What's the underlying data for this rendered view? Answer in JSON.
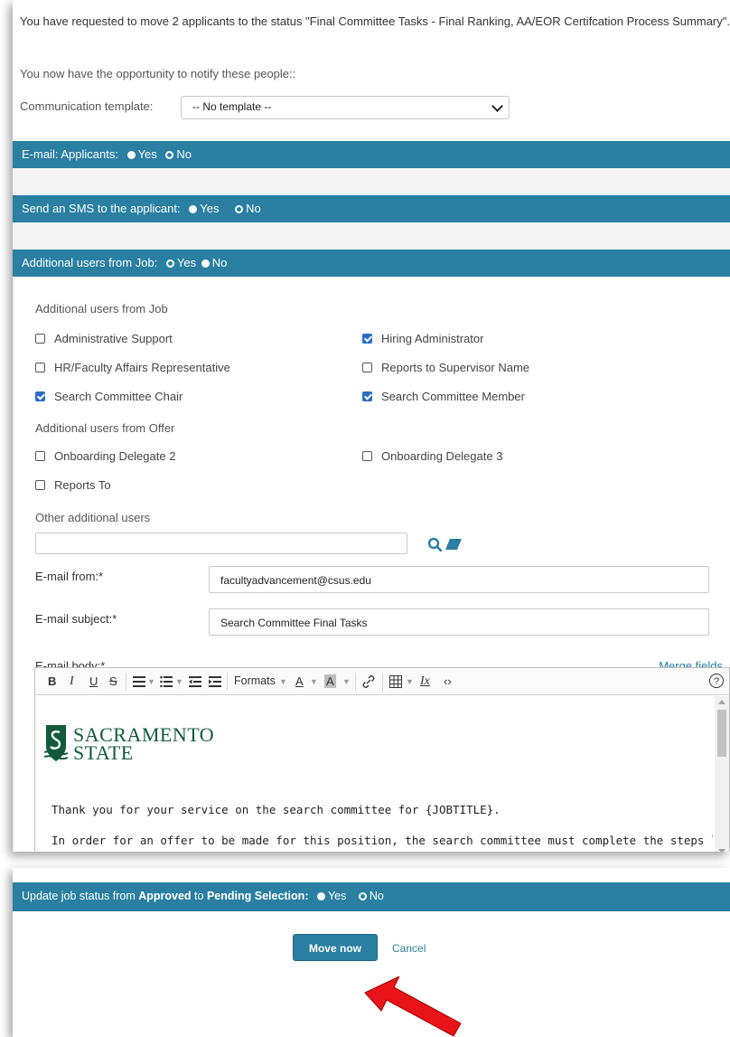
{
  "intro": {
    "message": "You have requested to move 2 applicants to the status \"Final Committee Tasks - Final Ranking, AA/EOR Certifcation Process Summary\".",
    "notify_text": "You now have the opportunity to notify these people::"
  },
  "template": {
    "label": "Communication template:",
    "selected": "-- No template --"
  },
  "email_applicants": {
    "label": "E-mail: Applicants:",
    "yes": "Yes",
    "no": "No",
    "value": "No"
  },
  "sms": {
    "label": "Send an SMS to the applicant:",
    "yes": "Yes",
    "no": "No",
    "value": "No"
  },
  "additional_users": {
    "label": "Additional users from Job:",
    "yes": "Yes",
    "no": "No",
    "value": "Yes",
    "job_group_label": "Additional users from Job",
    "job_options": [
      {
        "label": "Administrative Support",
        "checked": false
      },
      {
        "label": "Hiring Administrator",
        "checked": true
      },
      {
        "label": "HR/Faculty Affairs Representative",
        "checked": false
      },
      {
        "label": "Reports to Supervisor Name",
        "checked": false
      },
      {
        "label": "Search Committee Chair",
        "checked": true
      },
      {
        "label": "Search Committee Member",
        "checked": true
      }
    ],
    "offer_group_label": "Additional users from Offer",
    "offer_options": [
      {
        "label": "Onboarding Delegate 2",
        "checked": false
      },
      {
        "label": "Onboarding Delegate 3",
        "checked": false
      },
      {
        "label": "Reports To",
        "checked": false
      }
    ],
    "other_label": "Other additional users",
    "other_value": ""
  },
  "email": {
    "from_label": "E-mail from:*",
    "from_value": "facultyadvancement@csus.edu",
    "subject_label": "E-mail subject:*",
    "subject_value": "Search Committee Final Tasks",
    "body_label": "E-mail body:*",
    "merge_fields": "Merge fields"
  },
  "editor": {
    "toolbar": {
      "bold": "B",
      "italic": "I",
      "underline": "U",
      "strike": "S",
      "formats": "Formats",
      "font_color": "A",
      "bg_color": "A",
      "clear": "Ix",
      "help": "?"
    },
    "logo_line1": "SACRAMENTO",
    "logo_line2": "STATE",
    "line1": "Thank you for your service on the search committee for {JOBTITLE}.",
    "line2": "In order for an offer to be made for this position, the search committee must complete the steps listed"
  },
  "job_status": {
    "label_prefix": "Update job status from ",
    "from": "Approved",
    "middle": " to ",
    "to": "Pending Selection",
    "suffix": ":",
    "yes": "Yes",
    "no": "No",
    "value": "No"
  },
  "actions": {
    "move_now": "Move now",
    "cancel": "Cancel"
  },
  "colors": {
    "accent": "#2a7fa3",
    "checkbox": "#2a6cc4",
    "arrow": "#e8141a",
    "logo": "#125a3a"
  }
}
